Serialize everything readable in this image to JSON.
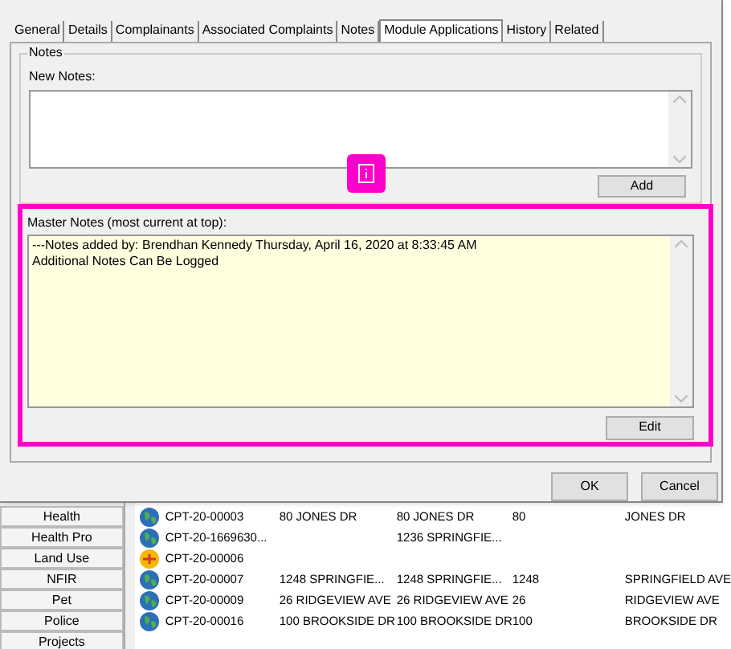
{
  "tabs": [
    {
      "label": "General",
      "selected": false
    },
    {
      "label": "Details",
      "selected": false
    },
    {
      "label": "Complainants",
      "selected": false
    },
    {
      "label": "Associated Complaints",
      "selected": false
    },
    {
      "label": "Notes",
      "selected": false
    },
    {
      "label": "Module Applications",
      "selected": true
    },
    {
      "label": "History",
      "selected": false
    },
    {
      "label": "Related",
      "selected": false
    }
  ],
  "notes_group": {
    "title": "Notes",
    "new_notes_label": "New Notes:",
    "add_button": "Add"
  },
  "master_notes": {
    "label": "Master Notes (most current at top):",
    "lines": [
      "---Notes added by: Brendhan Kennedy Thursday, April 16, 2020 at 8:33:45 AM",
      "Additional Notes Can Be Logged"
    ],
    "edit_button": "Edit"
  },
  "dialog_buttons": [
    "OK",
    "Cancel"
  ],
  "sidebar": {
    "items": [
      "Health",
      "Health Pro",
      "Land Use",
      "NFIR",
      "Pet",
      "Police",
      "Projects"
    ]
  },
  "list_rows": [
    {
      "kind": "globe",
      "id": "CPT-20-00003",
      "column_2": "80 JONES DR",
      "column_3": "80 JONES DR",
      "column_4": "80",
      "column_5": "JONES DR"
    },
    {
      "kind": "globe",
      "id": "CPT-20-1669630...",
      "column_3": "1236 SPRINGFIE..."
    },
    {
      "kind": "warning",
      "id": "CPT-20-00006"
    },
    {
      "kind": "globe",
      "id": "CPT-20-00007",
      "column_2": "1248 SPRINGFIE...",
      "column_3": "1248 SPRINGFIE...",
      "column_4": "1248",
      "column_5": "SPRINGFIELD AVE"
    },
    {
      "kind": "globe",
      "id": "CPT-20-00009",
      "column_2": "26 RIDGEVIEW AVE",
      "column_3": "26 RIDGEVIEW AVE",
      "column_4": "26",
      "column_5": "RIDGEVIEW AVE"
    },
    {
      "kind": "globe",
      "id": "CPT-20-00016",
      "column_2": "100 BROOKSIDE DR",
      "column_3": "100 BROOKSIDE DR",
      "column_4": "100",
      "column_5": "BROOKSIDE DR"
    }
  ]
}
